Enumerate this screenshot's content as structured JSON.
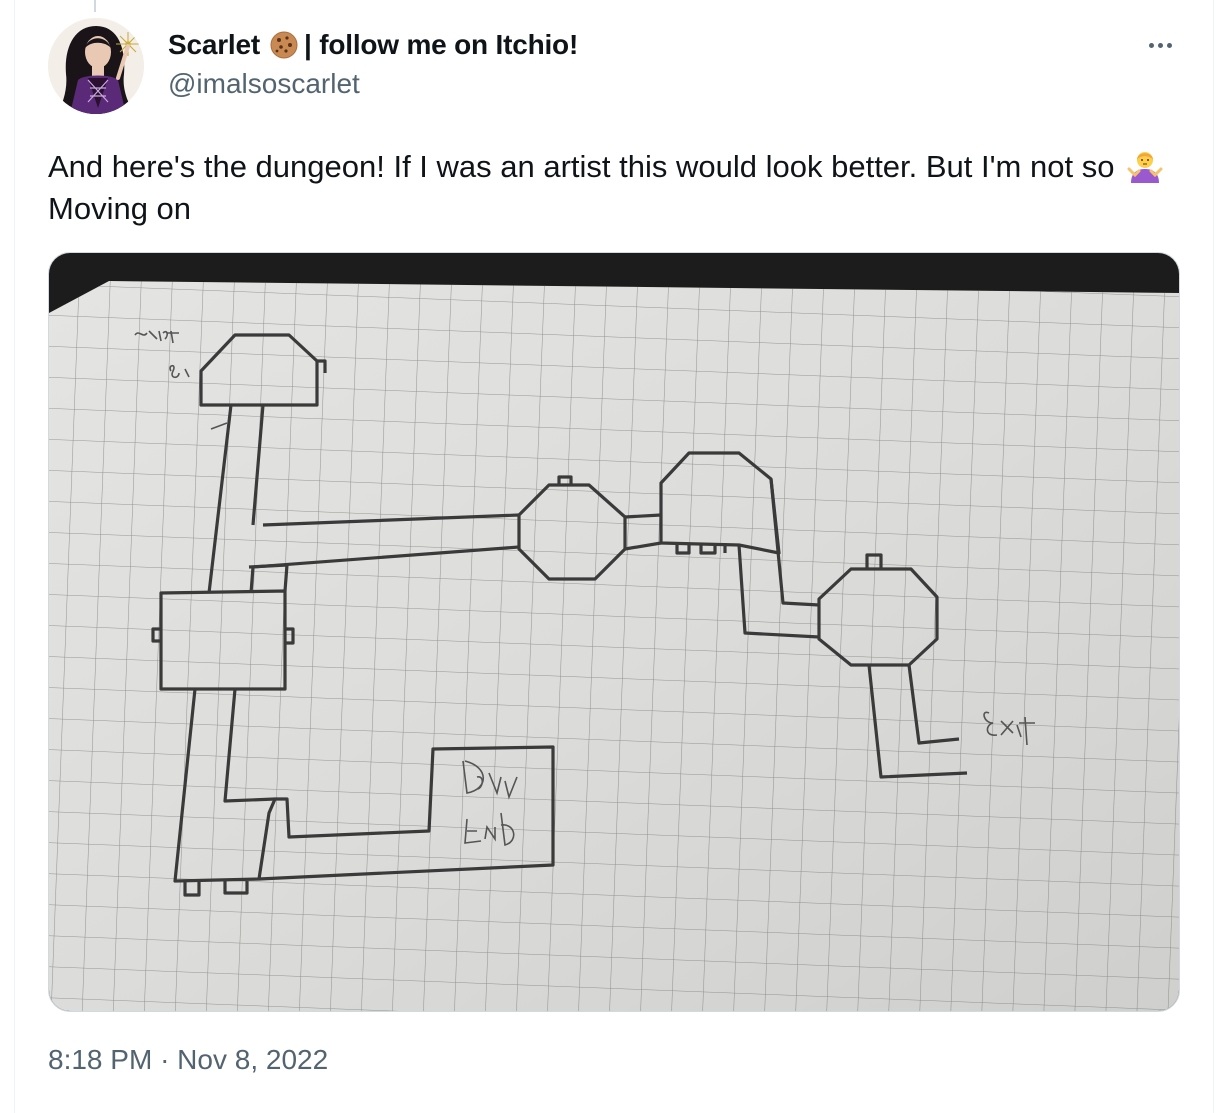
{
  "author": {
    "display_name": "Scarlet",
    "name_suffix": "| follow me on Itchio!",
    "handle": "@imalsoscarlet",
    "avatar_icon": "avatar-portrait",
    "name_emoji": "cookie-emoji"
  },
  "tweet": {
    "text_part1": "And here's the dungeon! If I was an artist this would look better. But I'm not so",
    "emoji": "person-shrugging-emoji",
    "text_part2": "Moving on"
  },
  "media": {
    "description_icon": "graph-paper-dungeon-map",
    "handwritten_labels": [
      "Start",
      "Dead End",
      "Exit"
    ]
  },
  "meta": {
    "time": "8:18 PM",
    "separator": "·",
    "date": "Nov 8, 2022"
  },
  "colors": {
    "text_primary": "#0f1419",
    "text_secondary": "#536471",
    "border": "#cfd9de"
  }
}
